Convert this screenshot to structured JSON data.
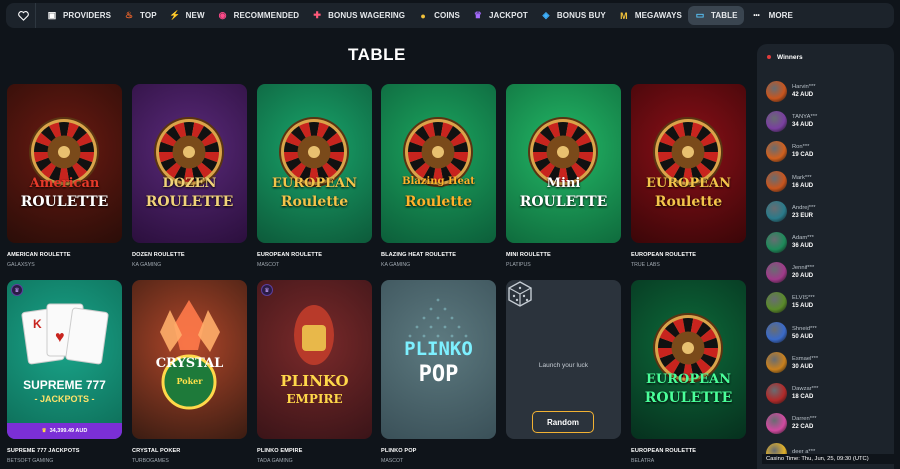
{
  "nav": {
    "items": [
      {
        "label": "PROVIDERS",
        "icon": "providers-icon",
        "color": "#ffffff"
      },
      {
        "label": "TOP",
        "icon": "fire-icon",
        "color": "#ff6a2b"
      },
      {
        "label": "NEW",
        "icon": "lightning-icon",
        "color": "#2fd16b"
      },
      {
        "label": "RECOMMENDED",
        "icon": "recommended-icon",
        "color": "#ff4a8a"
      },
      {
        "label": "BONUS WAGERING",
        "icon": "gift-icon",
        "color": "#ff5a7a"
      },
      {
        "label": "COINS",
        "icon": "coins-icon",
        "color": "#f2c23a"
      },
      {
        "label": "JACKPOT",
        "icon": "crown-icon",
        "color": "#a66bff"
      },
      {
        "label": "BONUS BUY",
        "icon": "bonus-buy-icon",
        "color": "#3fb2ff"
      },
      {
        "label": "MEGAWAYS",
        "icon": "megaways-icon",
        "color": "#f2c23a"
      },
      {
        "label": "TABLE",
        "icon": "table-icon",
        "color": "#59c9ff"
      },
      {
        "label": "MORE",
        "icon": "more-icon",
        "color": "#ffffff"
      }
    ],
    "active": "TABLE"
  },
  "page": {
    "title": "TABLE"
  },
  "games": [
    {
      "name": "AMERICAN ROULETTE",
      "provider": "GALAXSYS",
      "art_line1": "American",
      "art_line2": "ROULETTE",
      "bg1": "#2a0d08",
      "bg2": "#6b1a12",
      "accent": "#e63a2a"
    },
    {
      "name": "DOZEN ROULETTE",
      "provider": "KA GAMING",
      "art_line1": "DOZEN",
      "art_line2": "ROULETTE",
      "bg1": "#2b0f3d",
      "bg2": "#5a2a7a",
      "accent": "#f1d37a"
    },
    {
      "name": "EUROPEAN ROULETTE",
      "provider": "MASCOT",
      "art_line1": "EUROPEAN",
      "art_line2": "Roulette",
      "bg1": "#0d5a3a",
      "bg2": "#19a56b",
      "accent": "#f4c44a"
    },
    {
      "name": "BLAZING HEAT ROULETTE",
      "provider": "KA GAMING",
      "art_line1": "Blazing Heat",
      "art_line2": "Roulette",
      "bg1": "#0c5e3a",
      "bg2": "#1ca65f",
      "accent": "#ffb22a"
    },
    {
      "name": "MINI ROULETTE",
      "provider": "PLATIPUS",
      "art_line1": "Mini",
      "art_line2": "ROULETTE",
      "bg1": "#0f6b3d",
      "bg2": "#23b866",
      "accent": "#ffffff"
    },
    {
      "name": "EUROPEAN ROULETTE",
      "provider": "TRUE LABS",
      "art_line1": "EUROPEAN",
      "art_line2": "Roulette",
      "bg1": "#3a0608",
      "bg2": "#8c1018",
      "accent": "#f4c44a"
    },
    {
      "name": "SUPREME 777 JACKPOTS",
      "provider": "BETSOFT GAMING",
      "art_line1": "SUPREME 777",
      "art_line2": "- JACKPOTS -",
      "jackpot": "34,399.49 AUD",
      "vip": true,
      "bg1": "#0d6b56",
      "bg2": "#1aa58a",
      "accent": "#ffe36a"
    },
    {
      "name": "CRYSTAL POKER",
      "provider": "TURBOGAMES",
      "art_line1": "CRYSTAL",
      "art_line2": "Poker",
      "bg1": "#3a1c12",
      "bg2": "#b0472a",
      "accent": "#ffe04a"
    },
    {
      "name": "PLINKO EMPIRE",
      "provider": "TADA GAMING",
      "art_line1": "PLINKO",
      "art_line2": "EMPIRE",
      "vip": true,
      "bg1": "#3a1418",
      "bg2": "#7a2a2a",
      "accent": "#ffd84a"
    },
    {
      "name": "PLINKO POP",
      "provider": "MASCOT",
      "art_line1": "PLINKO",
      "art_line2": "POP",
      "bg1": "#3a5058",
      "bg2": "#5d7a80",
      "accent": "#7df0ff"
    },
    {
      "name": "EUROPEAN ROULETTE",
      "provider": "BELATRA",
      "art_line1": "EUROPEAN",
      "art_line2": "ROULETTE",
      "bg1": "#06301e",
      "bg2": "#0d6b3a",
      "accent": "#4aff9a"
    }
  ],
  "random_card": {
    "text": "Launch your luck",
    "button": "Random"
  },
  "winners": {
    "title": "Winners",
    "items": [
      {
        "name": "Harvin***",
        "amount": "42 AUD",
        "color": "#c8551e"
      },
      {
        "name": "TANYA***",
        "amount": "34 AUD",
        "color": "#7a3fa0"
      },
      {
        "name": "Ron***",
        "amount": "19 CAD",
        "color": "#d0601e"
      },
      {
        "name": "Mark***",
        "amount": "16 AUD",
        "color": "#c8551e"
      },
      {
        "name": "Andrej***",
        "amount": "23 EUR",
        "color": "#2a7a8a"
      },
      {
        "name": "Adam***",
        "amount": "36 AUD",
        "color": "#1e8a5a"
      },
      {
        "name": "Jennif***",
        "amount": "20 AUD",
        "color": "#a03a8a"
      },
      {
        "name": "ELVIS***",
        "amount": "15 AUD",
        "color": "#5a8a2a"
      },
      {
        "name": "Shneid***",
        "amount": "50 AUD",
        "color": "#3a6ac8"
      },
      {
        "name": "Esmael***",
        "amount": "30 AUD",
        "color": "#c8801e"
      },
      {
        "name": "Dawzar***",
        "amount": "18 CAD",
        "color": "#b02a2a"
      },
      {
        "name": "Darren***",
        "amount": "22 CAD",
        "color": "#d04aa0"
      },
      {
        "name": "deer a***",
        "amount": "",
        "color": "#e0b02a"
      }
    ]
  },
  "casino_time": "Casino Time: Thu, Jun, 25, 09:30 (UTC)"
}
